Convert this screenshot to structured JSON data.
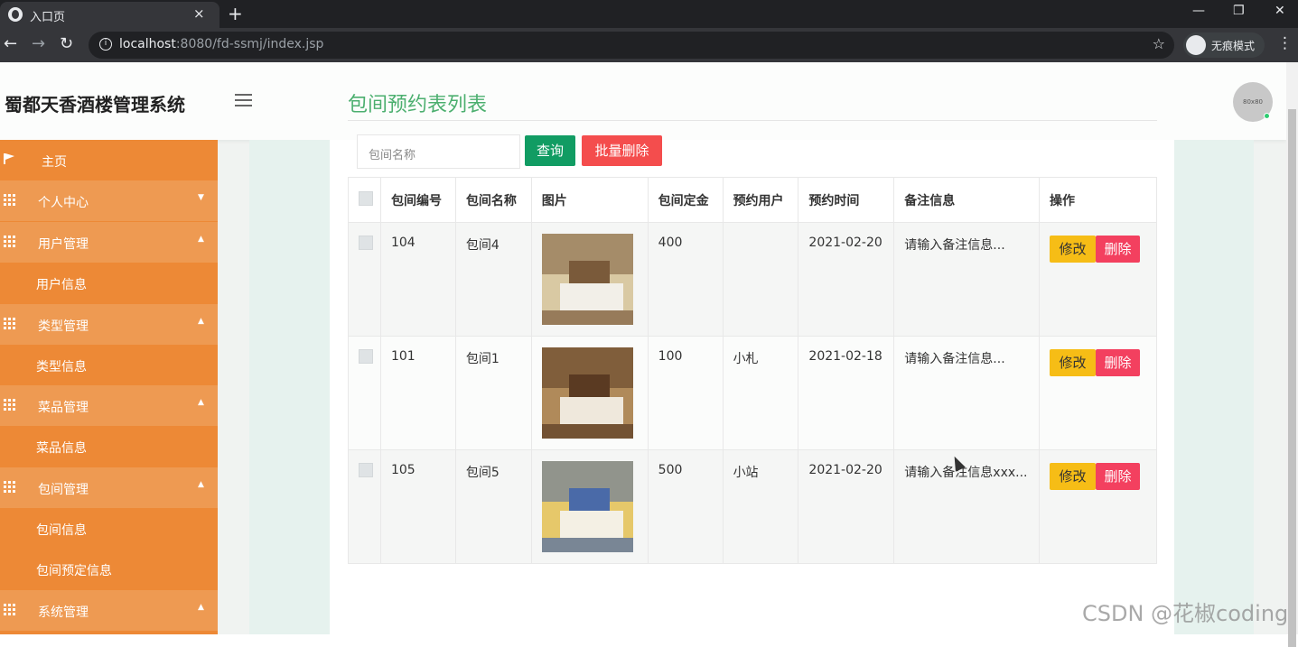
{
  "browser": {
    "tab_title": "入口页",
    "tab_close": "×",
    "new_tab": "+",
    "url_host": "localhost",
    "url_path": ":8080/fd-ssmj/index.jsp",
    "incognito_label": "无痕模式",
    "win_min": "—",
    "win_restore": "❐",
    "win_close": "✕"
  },
  "header": {
    "brand": "蜀都天香酒楼管理系统",
    "avatar_text": "80x80"
  },
  "sidebar": {
    "items": [
      {
        "label": "主页",
        "type": "top"
      },
      {
        "label": "个人中心",
        "type": "group"
      },
      {
        "label": "用户管理",
        "type": "group"
      },
      {
        "label": "用户信息",
        "type": "sub"
      },
      {
        "label": "类型管理",
        "type": "group"
      },
      {
        "label": "类型信息",
        "type": "sub"
      },
      {
        "label": "菜品管理",
        "type": "group"
      },
      {
        "label": "菜品信息",
        "type": "sub"
      },
      {
        "label": "包间管理",
        "type": "group"
      },
      {
        "label": "包间信息",
        "type": "sub"
      },
      {
        "label": "包间预定信息",
        "type": "sub"
      },
      {
        "label": "系统管理",
        "type": "group"
      }
    ]
  },
  "main": {
    "title": "包间预约表列表",
    "search_placeholder": "包间名称",
    "query_button": "查询",
    "batch_delete_button": "批量删除",
    "columns": [
      "包间编号",
      "包间名称",
      "图片",
      "包间定金",
      "预约用户",
      "预约时间",
      "备注信息",
      "操作"
    ],
    "rows": [
      {
        "id": "104",
        "name": "包间4",
        "deposit": "400",
        "user": "",
        "time": "2021-02-20",
        "note": "请输入备注信息..."
      },
      {
        "id": "101",
        "name": "包间1",
        "deposit": "100",
        "user": "小札",
        "time": "2021-02-18",
        "note": "请输入备注信息..."
      },
      {
        "id": "105",
        "name": "包间5",
        "deposit": "500",
        "user": "小站",
        "time": "2021-02-20",
        "note": "请输入备注信息xxx..."
      }
    ],
    "edit_label": "修改",
    "delete_label": "删除"
  },
  "watermark": "CSDN @花椒coding",
  "colors": {
    "sidebar": "#ed8936",
    "title": "#4caf6f",
    "query": "#119c63",
    "danger": "#f44d4d",
    "edit": "#f6bd16"
  }
}
